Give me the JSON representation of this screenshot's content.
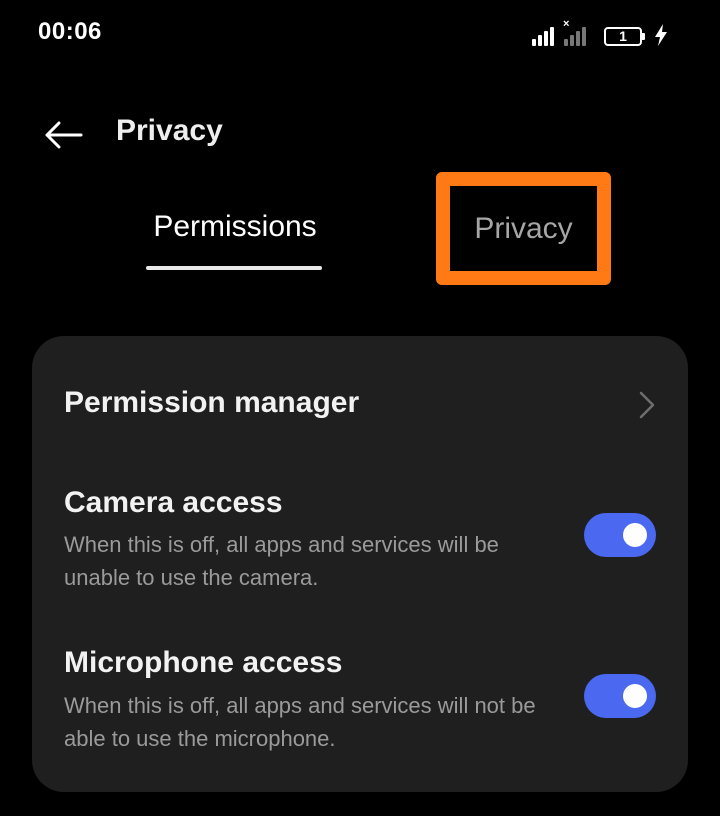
{
  "status_bar": {
    "time": "00:06",
    "battery_level": "1",
    "icons": [
      "signal-icon",
      "signal-no-service-icon",
      "battery-icon",
      "charging-bolt-icon"
    ]
  },
  "header": {
    "back_icon": "back-arrow-icon",
    "title": "Privacy"
  },
  "tabs": [
    {
      "label": "Permissions",
      "selected": true
    },
    {
      "label": "Privacy",
      "selected": false,
      "highlighted": true
    }
  ],
  "settings": {
    "permission_manager": {
      "label": "Permission manager",
      "icon": "chevron-right-icon"
    },
    "camera_access": {
      "title": "Camera access",
      "description": "When this is off, all apps and services will be unable to use the camera.",
      "enabled": true
    },
    "microphone_access": {
      "title": "Microphone access",
      "description": "When this is off, all apps and services will not be able to use the microphone.",
      "enabled": true
    }
  },
  "colors": {
    "background": "#000000",
    "card": "#1f1f1f",
    "toggle_on": "#4a68f0",
    "highlight": "#ff7a14",
    "secondary_text": "#9a9a9a"
  }
}
